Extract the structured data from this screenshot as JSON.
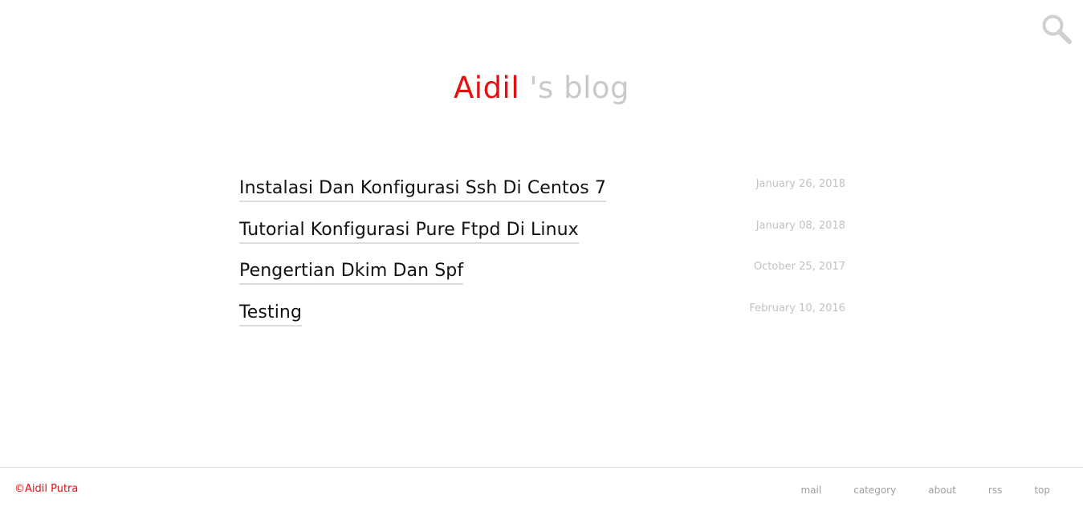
{
  "header": {
    "brand": "Aidil",
    "title_rest": " 's blog",
    "search_icon": "search-icon"
  },
  "posts": [
    {
      "title": "Instalasi Dan Konfigurasi Ssh Di Centos 7",
      "date": "January 26, 2018"
    },
    {
      "title": "Tutorial Konfigurasi Pure Ftpd Di Linux",
      "date": "January 08, 2018"
    },
    {
      "title": "Pengertian Dkim Dan Spf",
      "date": "October 25, 2017"
    },
    {
      "title": "Testing",
      "date": "February 10, 2016"
    }
  ],
  "footer": {
    "copyright": "©Aidil Putra",
    "links": [
      "mail",
      "category",
      "about",
      "rss",
      "top"
    ]
  },
  "colors": {
    "brand_red": "#e60f0f",
    "muted_title": "#c9c9c9",
    "date_gray": "#c2c2c2",
    "footer_link": "#9e9e9e"
  }
}
